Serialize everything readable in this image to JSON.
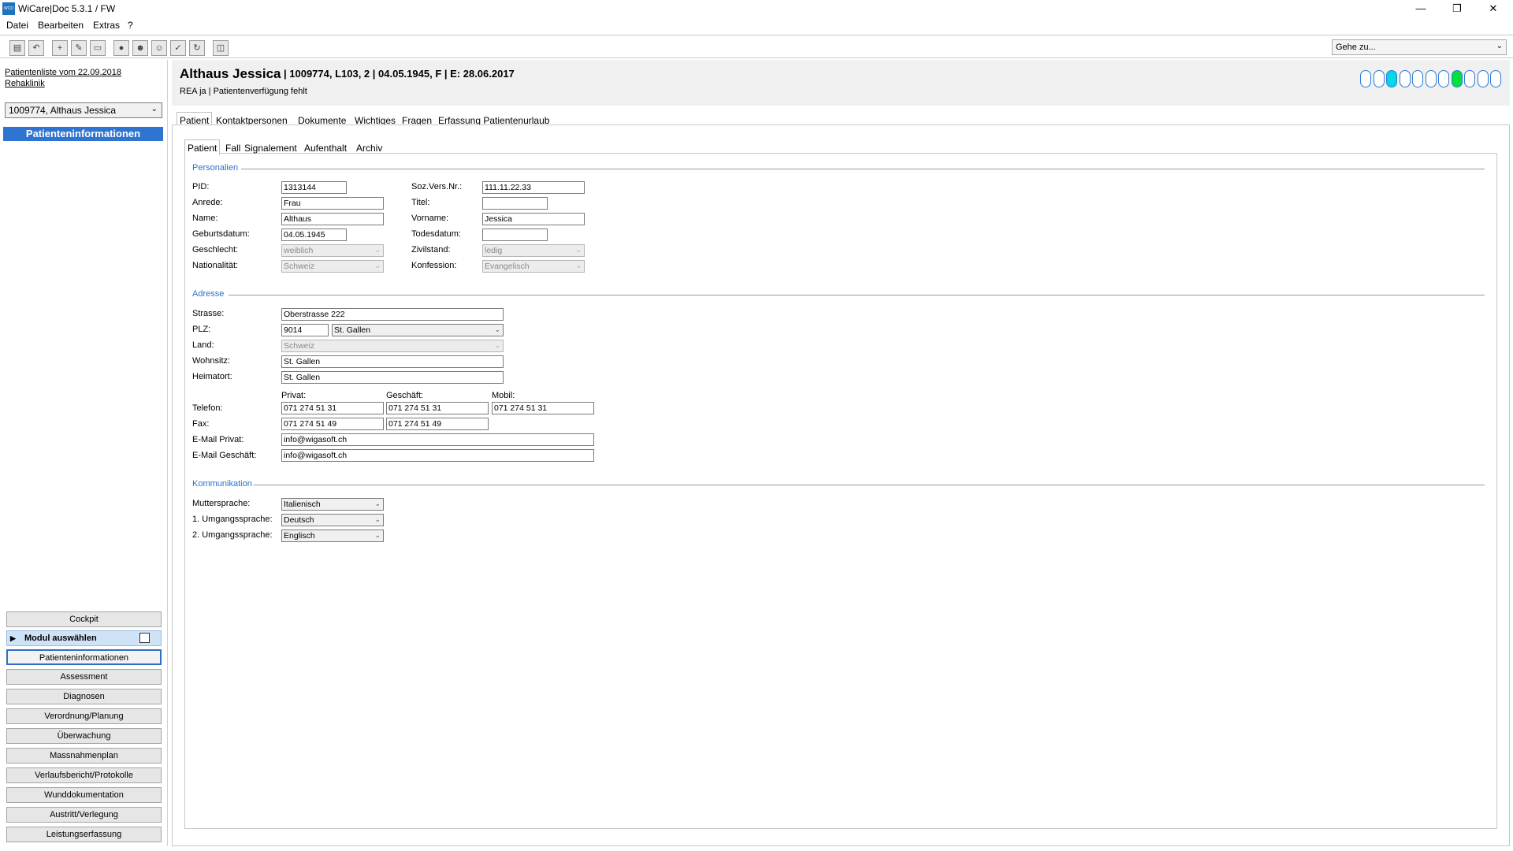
{
  "window": {
    "title": "WiCare|Doc 5.3.1  / FW",
    "icon_text": "WCD"
  },
  "menu": [
    "Datei",
    "Bearbeiten",
    "Extras",
    "?"
  ],
  "toolbar": {
    "goto_placeholder": "Gehe zu..."
  },
  "sidebar": {
    "list_link": "Patientenliste vom 22.09.2018",
    "clinic_link": "Rehaklinik",
    "patient_select": "1009774, Althaus Jessica",
    "heading": "Patienteninformationen",
    "cockpit": "Cockpit",
    "modul": "Modul auswählen",
    "nav": [
      "Patienteninformationen",
      "Assessment",
      "Diagnosen",
      "Verordnung/Planung",
      "Überwachung",
      "Massnahmenplan",
      "Verlaufsbericht/Protokolle",
      "Wunddokumentation",
      "Austritt/Verlegung",
      "Leistungserfassung"
    ]
  },
  "header": {
    "name": "Althaus Jessica",
    "info": "| 1009774, L103, 2 | 04.05.1945, F | E: 28.06.2017",
    "sub": "REA ja | Patientenverfügung fehlt",
    "status_colors": [
      "#ffffff",
      "#ffffff",
      "#00d8e8",
      "#ffffff",
      "#ffffff",
      "#ffffff",
      "#ffffff",
      "#00e040",
      "#ffffff",
      "#ffffff",
      "#ffffff"
    ]
  },
  "tabs": [
    "Patient",
    "Kontaktpersonen",
    "Dokumente",
    "Wichtiges",
    "Fragen",
    "Erfassung Patientenurlaub"
  ],
  "subtabs": [
    "Patient",
    "Fall",
    "Signalement",
    "Aufenthalt",
    "Archiv"
  ],
  "personalien": {
    "section": "Personalien",
    "pid_label": "PID:",
    "pid": "1313144",
    "anrede_label": "Anrede:",
    "anrede": "Frau",
    "name_label": "Name:",
    "name": "Althaus",
    "geburt_label": "Geburtsdatum:",
    "geburt": "04.05.1945",
    "geschlecht_label": "Geschlecht:",
    "geschlecht": "weiblich",
    "nation_label": "Nationalität:",
    "nation": "Schweiz",
    "sozvers_label": "Soz.Vers.Nr.:",
    "sozvers": "111.11.22.33",
    "titel_label": "Titel:",
    "titel": "",
    "vorname_label": "Vorname:",
    "vorname": "Jessica",
    "tod_label": "Todesdatum:",
    "tod": "",
    "zivil_label": "Zivilstand:",
    "zivil": "ledig",
    "konf_label": "Konfession:",
    "konf": "Evangelisch"
  },
  "adresse": {
    "section": "Adresse",
    "strasse_label": "Strasse:",
    "strasse": "Oberstrasse 222",
    "plz_label": "PLZ:",
    "plz": "9014",
    "ort": "St. Gallen",
    "land_label": "Land:",
    "land": "Schweiz",
    "wohnsitz_label": "Wohnsitz:",
    "wohnsitz": "St. Gallen",
    "heimatort_label": "Heimatort:",
    "heimatort": "St. Gallen",
    "privat_label": "Privat:",
    "geschaeft_label": "Geschäft:",
    "mobil_label": "Mobil:",
    "telefon_label": "Telefon:",
    "tel_privat": "071 274 51 31",
    "tel_geschaeft": "071 274 51 31",
    "tel_mobil": "071 274 51 31",
    "fax_label": "Fax:",
    "fax_privat": "071 274 51 49",
    "fax_geschaeft": "071 274 51 49",
    "email_privat_label": "E-Mail Privat:",
    "email_privat": "info@wigasoft.ch",
    "email_geschaeft_label": "E-Mail Geschäft:",
    "email_geschaeft": "info@wigasoft.ch"
  },
  "kommunikation": {
    "section": "Kommunikation",
    "mutter_label": "Muttersprache:",
    "mutter": "Italienisch",
    "umg1_label": "1. Umgangssprache:",
    "umg1": "Deutsch",
    "umg2_label": "2. Umgangssprache:",
    "umg2": "Englisch"
  }
}
